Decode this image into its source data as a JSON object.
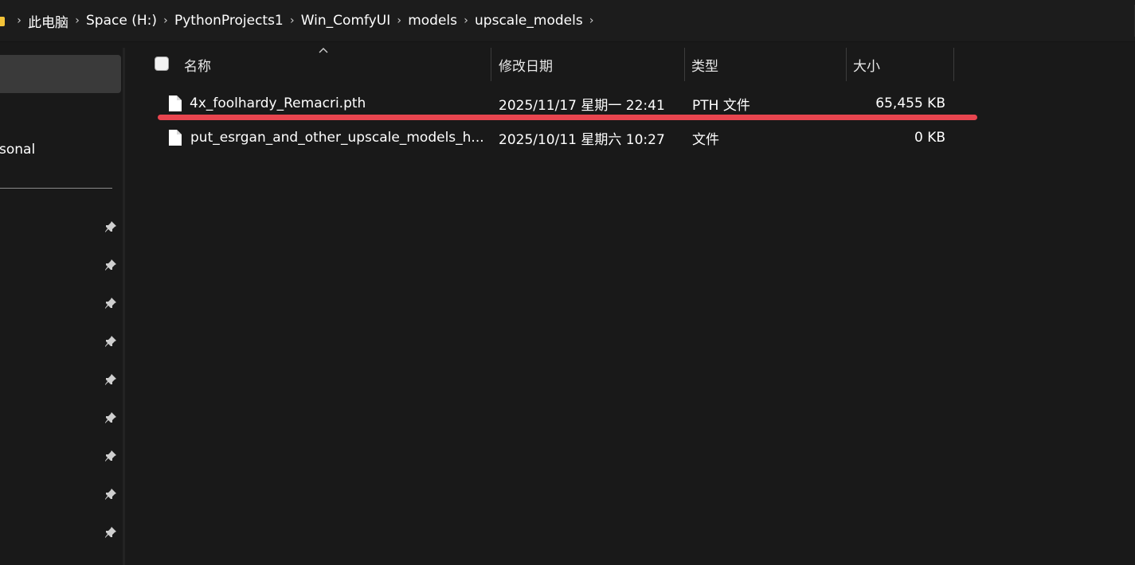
{
  "breadcrumb": {
    "items": [
      "此电脑",
      "Space (H:)",
      "PythonProjects1",
      "Win_ComfyUI",
      "models",
      "upscale_models"
    ],
    "separator": "›"
  },
  "nav": {
    "partial_label": "rsonal"
  },
  "columns": {
    "name": "名称",
    "modified": "修改日期",
    "type": "类型",
    "size": "大小"
  },
  "files": [
    {
      "name": "4x_foolhardy_Remacri.pth",
      "modified": "2025/11/17 星期一 22:41",
      "type": "PTH 文件",
      "size": "65,455 KB"
    },
    {
      "name": "put_esrgan_and_other_upscale_models_h...",
      "modified": "2025/10/11 星期六 10:27",
      "type": "文件",
      "size": "0 KB"
    }
  ],
  "colors": {
    "background": "#191919",
    "annotation": "#e8454f",
    "folder": "#f3c338"
  },
  "icons": {
    "folder": "folder-icon",
    "file": "file-icon",
    "pin": "pin-icon",
    "sort": "sort-up-icon",
    "chevron": "chevron-right-icon"
  }
}
